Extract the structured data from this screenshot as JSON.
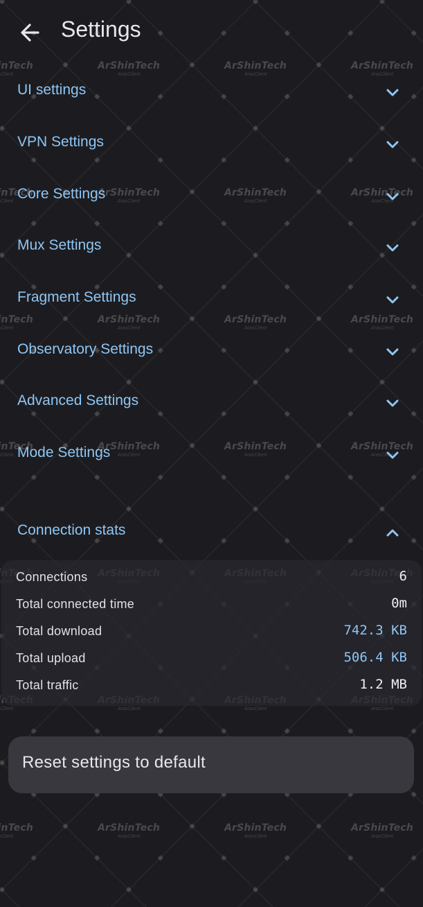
{
  "header": {
    "title": "Settings",
    "back_icon": "arrow-left-icon"
  },
  "sections": [
    {
      "label": "UI settings",
      "icon": "chevron-down-icon"
    },
    {
      "label": "VPN Settings",
      "icon": "chevron-down-icon"
    },
    {
      "label": "Core Settings",
      "icon": "chevron-down-icon"
    },
    {
      "label": "Mux Settings",
      "icon": "chevron-down-icon"
    },
    {
      "label": "Fragment Settings",
      "icon": "chevron-down-icon"
    },
    {
      "label": "Observatory Settings",
      "icon": "chevron-down-icon"
    },
    {
      "label": "Advanced Settings",
      "icon": "chevron-down-icon"
    },
    {
      "label": "Mode Settings",
      "icon": "chevron-down-icon"
    }
  ],
  "connection_stats": {
    "label": "Connection stats",
    "icon": "chevron-up-icon",
    "rows": [
      {
        "label": "Connections",
        "value": "6"
      },
      {
        "label": "Total connected time",
        "value": "0m"
      },
      {
        "label": "Total download",
        "value": "742.3 KB"
      },
      {
        "label": "Total upload",
        "value": "506.4 KB"
      },
      {
        "label": "Total traffic",
        "value": "1.2 MB"
      }
    ]
  },
  "reset": {
    "label": "Reset settings to default"
  },
  "watermark": {
    "text": "ArShinTech",
    "sub": "ArasClient"
  },
  "colors": {
    "background": "#1c1c20",
    "accent": "#8fc6f4",
    "text": "#e6e6ea",
    "card": "#2a2a30",
    "button": "#38383e"
  }
}
